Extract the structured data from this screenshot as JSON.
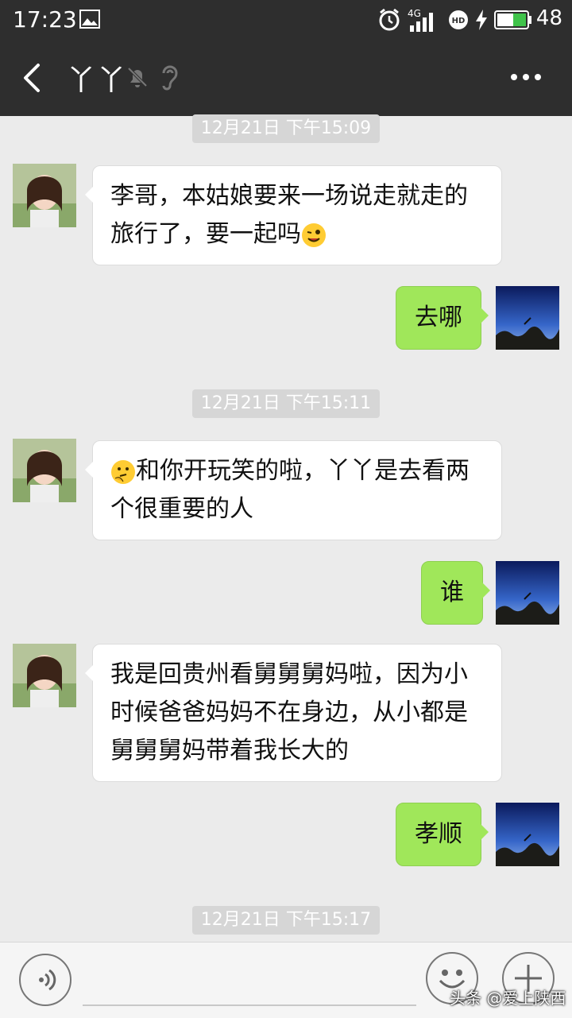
{
  "status_bar": {
    "time": "17:23",
    "network": "4G",
    "battery": "48"
  },
  "chat": {
    "title": "丫丫"
  },
  "messages": {
    "m1": {
      "time": "12月21日 下午15:09",
      "line1": "李哥，本姑娘要来一场说走就走的",
      "line2": "旅行了，要一起吗"
    },
    "m2": "去哪",
    "m3": {
      "time": "12月21日 下午15:11",
      "line1": "和你开玩笑的啦，丫丫是去看两",
      "line2": "个很重要的人"
    },
    "m4": "谁",
    "m5": {
      "line1": "我是回贵州看舅舅舅妈啦，因为小",
      "line2": "时候爸爸妈妈不在身边，从小都是",
      "line3": "舅舅舅妈带着我长大的"
    },
    "m6": "孝顺",
    "m7": {
      "time": "12月21日 下午15:17"
    }
  },
  "watermark": "头条 @爱上陕西",
  "colors": {
    "header": "#2e2e2e",
    "bubble_out": "#a0e75a",
    "bubble_in": "#ffffff",
    "background": "#ebebeb"
  },
  "icons": [
    "image-icon",
    "alarm-icon",
    "signal-icon",
    "hd-icon",
    "charging-icon",
    "battery-icon",
    "back-arrow-icon",
    "mute-bell-icon",
    "earpiece-icon",
    "more-icon",
    "voice-icon",
    "emoji-icon",
    "plus-icon",
    "wink-emoji-icon",
    "thinking-emoji-icon"
  ]
}
